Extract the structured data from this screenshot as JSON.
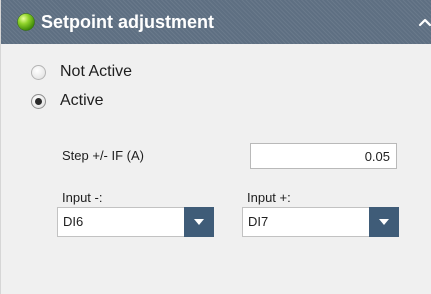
{
  "header": {
    "title": "Setpoint adjustment",
    "status_icon": "green-status-orb",
    "collapse_icon": "chevron-up-icon",
    "background_color": "#5e6f82"
  },
  "mode": {
    "options": [
      {
        "label": "Not Active",
        "selected": false
      },
      {
        "label": "Active",
        "selected": true
      }
    ]
  },
  "step": {
    "label": "Step +/- IF (A)",
    "value": "0.05"
  },
  "inputs": {
    "minus": {
      "label": "Input -:",
      "value": "DI6"
    },
    "plus": {
      "label": "Input +:",
      "value": "DI7"
    },
    "dropdown_color": "#3f5c78"
  }
}
